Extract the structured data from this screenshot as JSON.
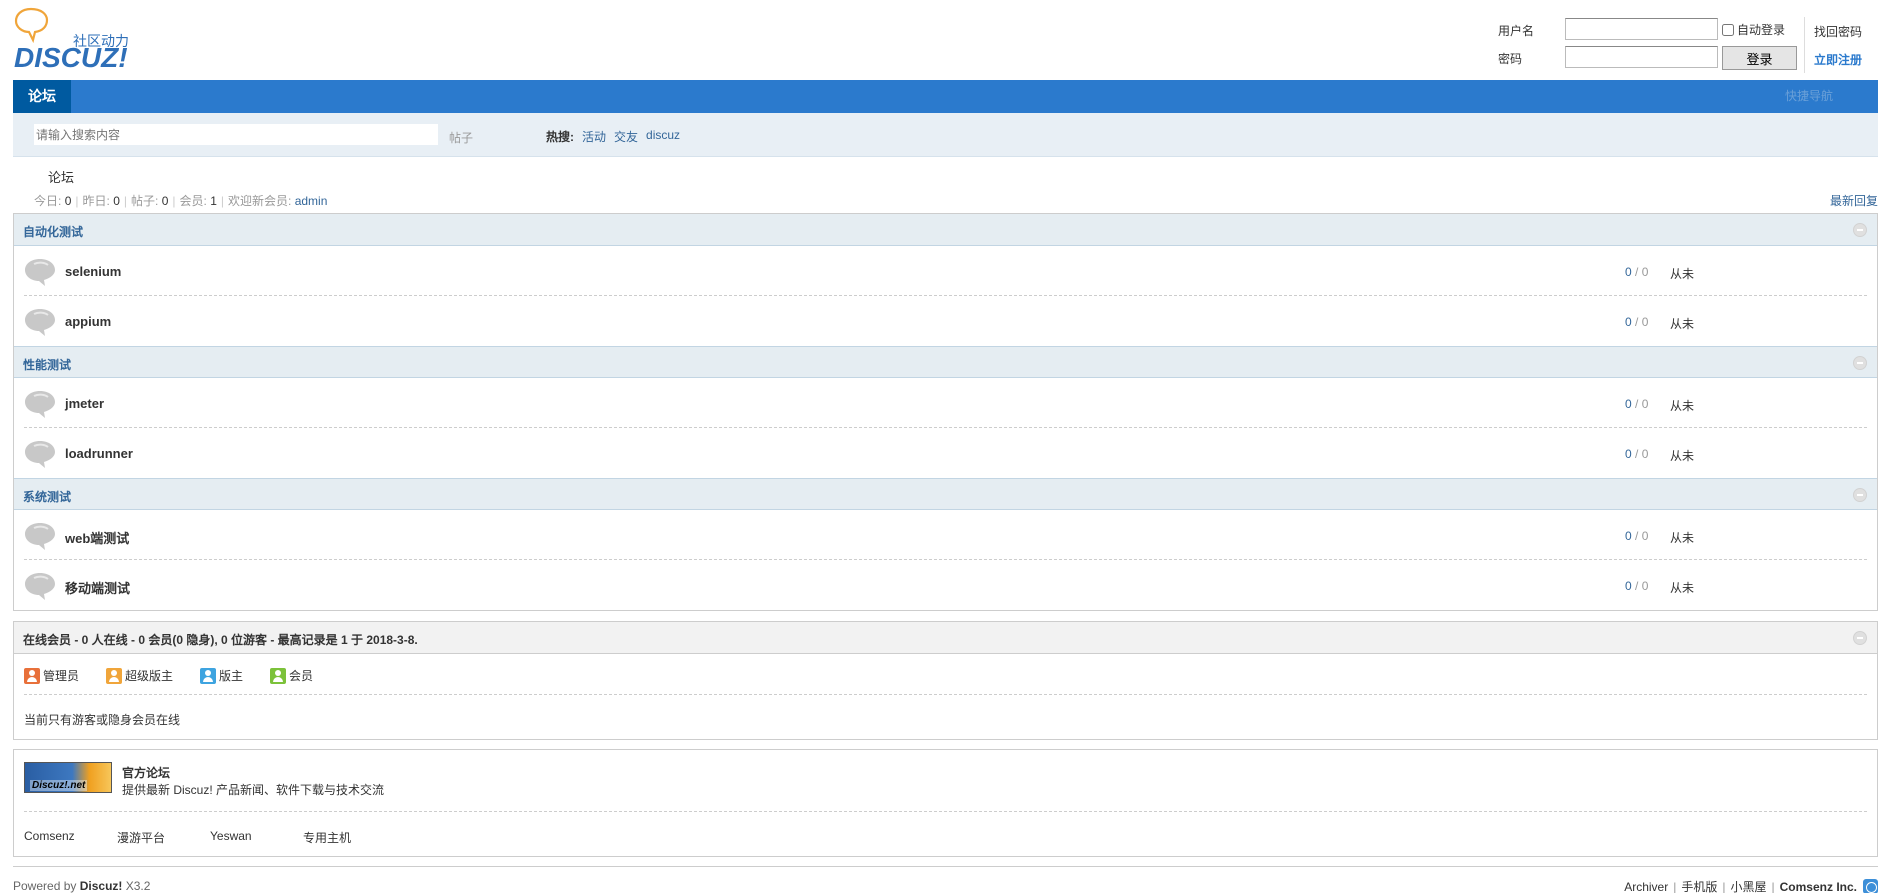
{
  "header": {
    "logo_text": "DISCUZ!",
    "logo_tagline": "社区动力",
    "login": {
      "username_label": "用户名",
      "password_label": "密码",
      "remember_label": "自动登录",
      "login_button": "登录",
      "forgot_link": "找回密码",
      "register_link": "立即注册"
    }
  },
  "nav": {
    "current": "论坛",
    "quick_nav": "快捷导航"
  },
  "search": {
    "placeholder": "请输入搜索内容",
    "type": "帖子",
    "hot_label": "热搜:",
    "hot_terms": [
      "活动",
      "交友",
      "discuz"
    ]
  },
  "breadcrumb": "论坛",
  "stats": {
    "today_label": "今日:",
    "today": "0",
    "yesterday_label": "昨日:",
    "yesterday": "0",
    "posts_label": "帖子:",
    "posts": "0",
    "members_label": "会员:",
    "members": "1",
    "welcome_label": "欢迎新会员:",
    "newest_member": "admin",
    "latest_replies": "最新回复"
  },
  "categories": [
    {
      "name": "自动化测试",
      "forums": [
        {
          "name": "selenium",
          "topics": "0",
          "posts": "0",
          "last": "从未"
        },
        {
          "name": "appium",
          "topics": "0",
          "posts": "0",
          "last": "从未"
        }
      ]
    },
    {
      "name": "性能测试",
      "forums": [
        {
          "name": "jmeter",
          "topics": "0",
          "posts": "0",
          "last": "从未"
        },
        {
          "name": "loadrunner",
          "topics": "0",
          "posts": "0",
          "last": "从未"
        }
      ]
    },
    {
      "name": "系统测试",
      "forums": [
        {
          "name": "web端测试",
          "topics": "0",
          "posts": "0",
          "last": "从未"
        },
        {
          "name": "移动端测试",
          "topics": "0",
          "posts": "0",
          "last": "从未"
        }
      ]
    }
  ],
  "count_separator": "/",
  "online": {
    "title": "在线会员 - 0 人在线 - 0 会员(0 隐身), 0 位游客 - 最高记录是 1 于 2018-3-8.",
    "legend": [
      {
        "label": "管理员",
        "color": "#e8703a"
      },
      {
        "label": "超级版主",
        "color": "#f0a53a"
      },
      {
        "label": "版主",
        "color": "#3ea4e0"
      },
      {
        "label": "会员",
        "color": "#7cc23a"
      }
    ],
    "note": "当前只有游客或隐身会员在线"
  },
  "links": {
    "badge_text": "Discuz!.net",
    "title": "官方论坛",
    "desc": "提供最新 Discuz! 产品新闻、软件下载与技术交流",
    "items": [
      "Comsenz",
      "漫游平台",
      "Yeswan",
      "专用主机"
    ]
  },
  "footer": {
    "powered": "Powered by",
    "brand": "Discuz!",
    "version": "X3.2",
    "links": [
      "Archiver",
      "手机版",
      "小黑屋"
    ],
    "company": "Comsenz Inc."
  }
}
